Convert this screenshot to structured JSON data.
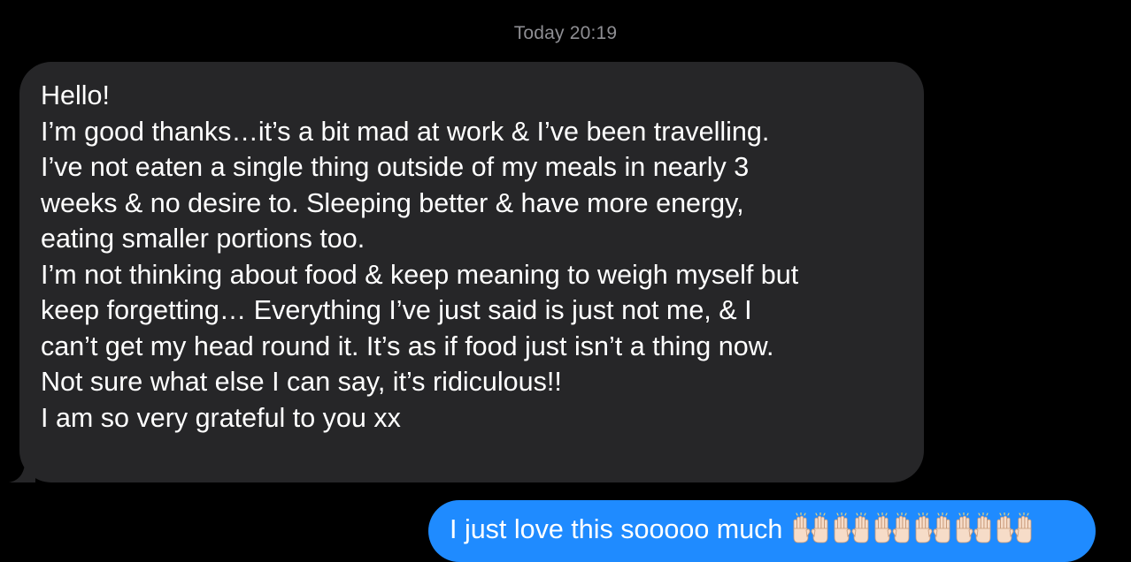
{
  "conversation": {
    "timestamp": "Today 20:19",
    "incoming": {
      "lines": [
        "Hello!",
        "I’m good thanks…it’s a bit mad at work & I’ve been travelling.",
        "I’ve not eaten a single thing outside of my meals in nearly 3",
        "weeks & no desire to. Sleeping better & have more energy,",
        "eating smaller portions too.",
        "I’m not thinking about food & keep meaning to weigh myself but",
        "keep forgetting… Everything I’ve just said is just not me, & I",
        "can’t get my head round it. It’s as if food just isn’t a thing now.",
        "Not sure what else I can say, it’s ridiculous!!",
        "I am so very grateful to you xx"
      ]
    },
    "outgoing": {
      "text": "I just love this sooooo much",
      "emoji": [
        "raising-hands-icon",
        "raising-hands-icon",
        "raising-hands-icon",
        "raising-hands-icon",
        "raising-hands-icon",
        "raising-hands-icon"
      ]
    }
  },
  "colors": {
    "background": "#000000",
    "incoming_bubble": "#262628",
    "outgoing_bubble": "#1f8bff",
    "timestamp": "#8e8e93",
    "text": "#ffffff"
  }
}
